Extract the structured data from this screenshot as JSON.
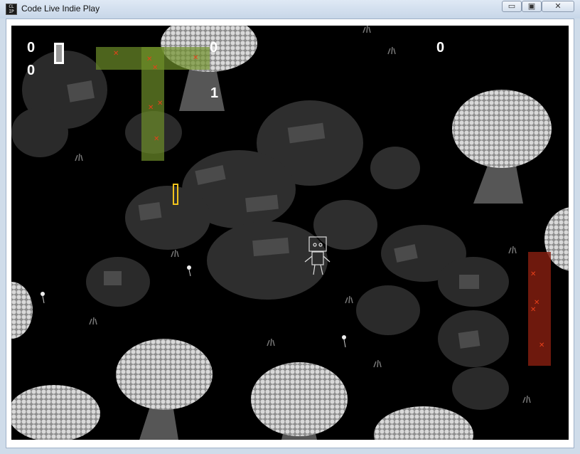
{
  "window": {
    "title": "Code Live Indie Play",
    "icon_text": "CL IP",
    "minimize_glyph": "▭",
    "maximize_glyph": "▣",
    "close_glyph": "✕"
  },
  "hud": {
    "top_left_count": "0",
    "second_count": "0",
    "banner_count": "0",
    "top_right_count": "0",
    "center_count": "1"
  },
  "colors": {
    "background": "#000000",
    "rock": "#3e3e3e",
    "tree_canopy": "#c8c8c8",
    "trunk": "#565656",
    "green_zone": "#6e8f2a",
    "red_zone": "#8a1f10",
    "marker": "#e8401a",
    "key_outline": "#f0c21c"
  },
  "icons": {
    "door": "door-icon",
    "player": "player-robot",
    "key": "key-pickup",
    "flower": "flower-icon"
  }
}
